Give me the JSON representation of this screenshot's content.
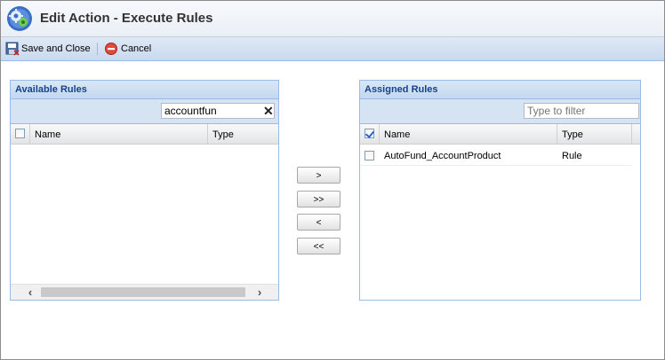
{
  "window": {
    "title": "Edit Action - Execute Rules"
  },
  "toolbar": {
    "save_label": "Save and Close",
    "cancel_label": "Cancel"
  },
  "available": {
    "title": "Available Rules",
    "filter_value": "accountfun",
    "columns": {
      "name": "Name",
      "type": "Type"
    },
    "rows": []
  },
  "assigned": {
    "title": "Assigned Rules",
    "filter_placeholder": "Type to filter",
    "columns": {
      "name": "Name",
      "type": "Type"
    },
    "rows": [
      {
        "name": "AutoFund_AccountProduct",
        "type": "Rule",
        "checked": false
      }
    ],
    "header_checked": true
  },
  "move_buttons": {
    "add": ">",
    "add_all": ">>",
    "remove": "<",
    "remove_all": "<<"
  },
  "colors": {
    "panel_border": "#99bbe8",
    "panel_title": "#15428b",
    "toolbar_bg": "#c9d9ee"
  }
}
